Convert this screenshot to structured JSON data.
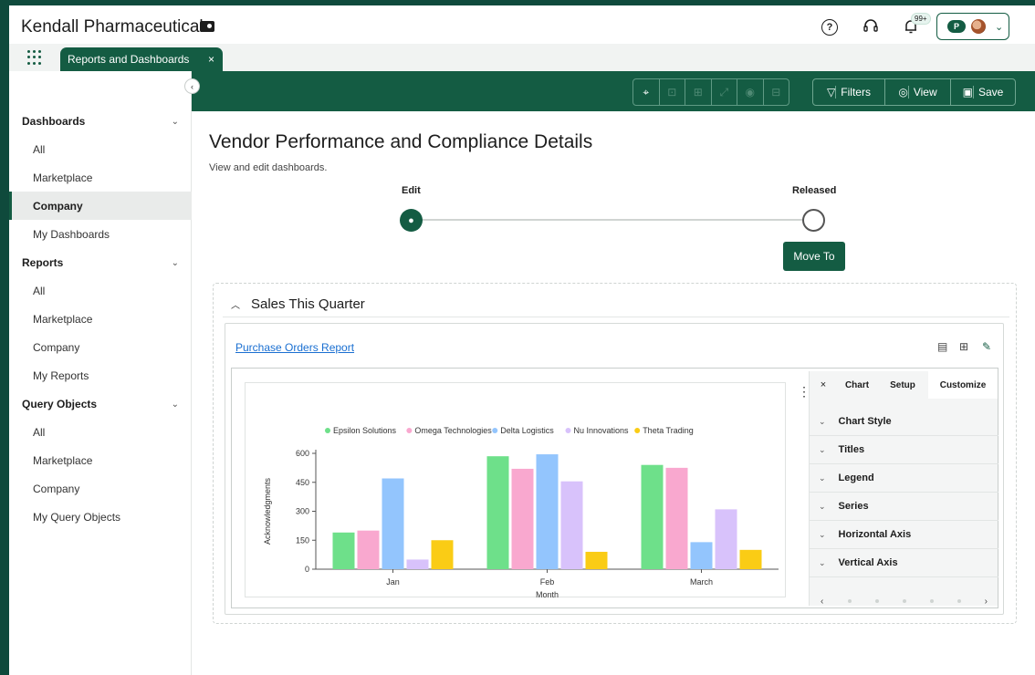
{
  "header": {
    "company_name": "Kendall Pharmaceuticals",
    "help_glyph": "?",
    "notification_badge": "99+",
    "account_initial": "P",
    "chevron": "⌄"
  },
  "tabbar": {
    "active_tab": "Reports and Dashboards",
    "close_glyph": "×"
  },
  "sidebar": {
    "collapse_glyph": "‹",
    "sections": [
      {
        "title": "Dashboards",
        "items": [
          "All",
          "Marketplace",
          "Company",
          "My Dashboards"
        ]
      },
      {
        "title": "Reports",
        "items": [
          "All",
          "Marketplace",
          "Company",
          "My Reports"
        ]
      },
      {
        "title": "Query Objects",
        "items": [
          "All",
          "Marketplace",
          "Company",
          "My Query Objects"
        ]
      }
    ],
    "active_section": "Dashboards",
    "active_item": "Company"
  },
  "toolbar": {
    "filters_label": "Filters",
    "view_label": "View",
    "save_label": "Save"
  },
  "page": {
    "title": "Vendor Performance and Compliance Details",
    "subtitle": "View and edit dashboards."
  },
  "workflow": {
    "stage_edit": "Edit",
    "stage_released": "Released",
    "move_button": "Move To"
  },
  "section": {
    "title": "Sales This Quarter",
    "report_link": "Purchase Orders Report"
  },
  "chart_panel": {
    "close_glyph": "×",
    "tabs": [
      "Chart",
      "Setup",
      "Customize"
    ],
    "active_tab": "Customize",
    "options": [
      "Chart Style",
      "Titles",
      "Legend",
      "Series",
      "Horizontal Axis",
      "Vertical Axis"
    ],
    "nav_prev": "‹",
    "nav_next": "›"
  },
  "colors": {
    "brand": "#145c43",
    "link": "#1a6fd1"
  },
  "chart_data": {
    "type": "bar",
    "categories": [
      "Jan",
      "Feb",
      "March"
    ],
    "series": [
      {
        "name": "Epsilon Solutions",
        "color": "#6ee08a",
        "values": [
          190,
          585,
          540
        ]
      },
      {
        "name": "Omega Technologies",
        "color": "#f9a8cf",
        "values": [
          200,
          520,
          525
        ]
      },
      {
        "name": "Delta Logistics",
        "color": "#93c5fd",
        "values": [
          470,
          595,
          140
        ]
      },
      {
        "name": "Nu Innovations",
        "color": "#d8c2fb",
        "values": [
          50,
          455,
          310
        ]
      },
      {
        "name": "Theta Trading",
        "color": "#facc15",
        "values": [
          150,
          90,
          100
        ]
      }
    ],
    "xlabel": "Month",
    "ylabel": "Acknowledgments",
    "ylim": [
      0,
      600
    ],
    "yticks": [
      0,
      150,
      300,
      450,
      600
    ],
    "legend": "top",
    "grid": false
  }
}
